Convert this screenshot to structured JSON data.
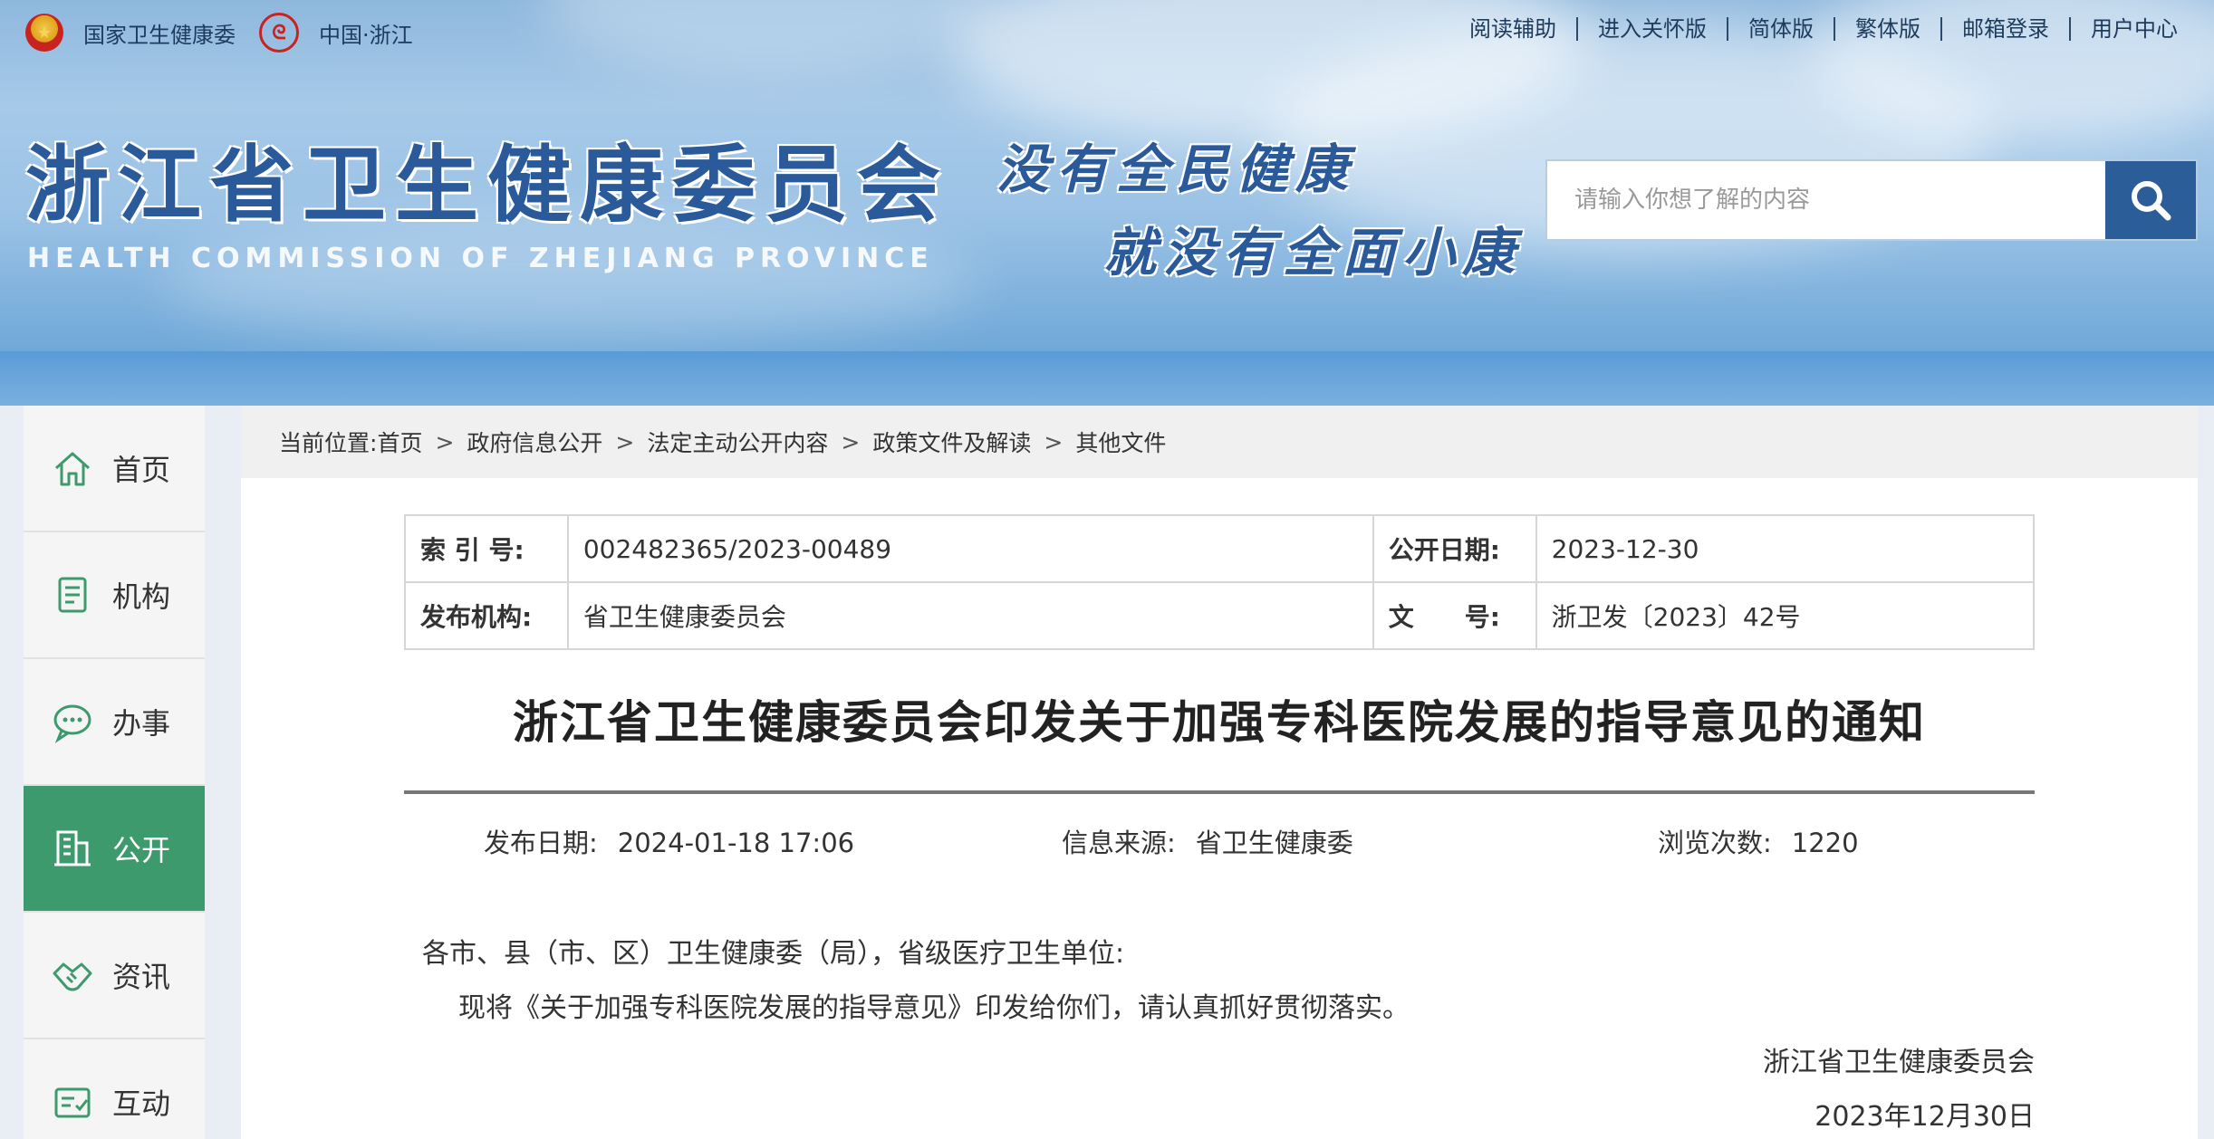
{
  "header": {
    "left_links": [
      "国家卫生健康委",
      "中国·浙江"
    ],
    "right_links": [
      "阅读辅助",
      "进入关怀版",
      "简体版",
      "繁体版",
      "邮箱登录",
      "用户中心"
    ],
    "site_title": "浙江省卫生健康委员会",
    "site_subtitle": "HEALTH COMMISSION OF ZHEJIANG PROVINCE",
    "slogan_line1": "没有全民健康",
    "slogan_line2": "就没有全面小康",
    "search_placeholder": "请输入你想了解的内容"
  },
  "sidebar": {
    "items": [
      {
        "label": "首页",
        "icon": "home-icon",
        "active": false
      },
      {
        "label": "机构",
        "icon": "org-icon",
        "active": false
      },
      {
        "label": "办事",
        "icon": "chat-icon",
        "active": false
      },
      {
        "label": "公开",
        "icon": "building-icon",
        "active": true
      },
      {
        "label": "资讯",
        "icon": "handshake-icon",
        "active": false
      },
      {
        "label": "互动",
        "icon": "interact-icon",
        "active": false
      }
    ],
    "active_color": "#3d9a6c"
  },
  "breadcrumb": {
    "prefix": "当前位置:",
    "items": [
      "首页",
      "政府信息公开",
      "法定主动公开内容",
      "政策文件及解读",
      "其他文件"
    ],
    "separator": ">"
  },
  "meta": {
    "index_label": "索 引 号:",
    "index_value": "002482365/2023-00489",
    "pubdate_label": "公开日期:",
    "pubdate_value": "2023-12-30",
    "issuer_label": "发布机构:",
    "issuer_value": "省卫生健康委员会",
    "docno_label": "文　　号:",
    "docno_value": "浙卫发〔2023〕42号"
  },
  "document": {
    "title": "浙江省卫生健康委员会印发关于加强专科医院发展的指导意见的通知",
    "publish_label": "发布日期:",
    "publish_value": "2024-01-18 17:06",
    "source_label": "信息来源:",
    "source_value": "省卫生健康委",
    "views_label": "浏览次数:",
    "views_value": "1220",
    "salutation": "各市、县（市、区）卫生健康委（局），省级医疗卫生单位:",
    "paragraph1": "现将《关于加强专科医院发展的指导意见》印发给你们，请认真抓好贯彻落实。",
    "signature": "浙江省卫生健康委员会",
    "sign_date": "2023年12月30日"
  }
}
